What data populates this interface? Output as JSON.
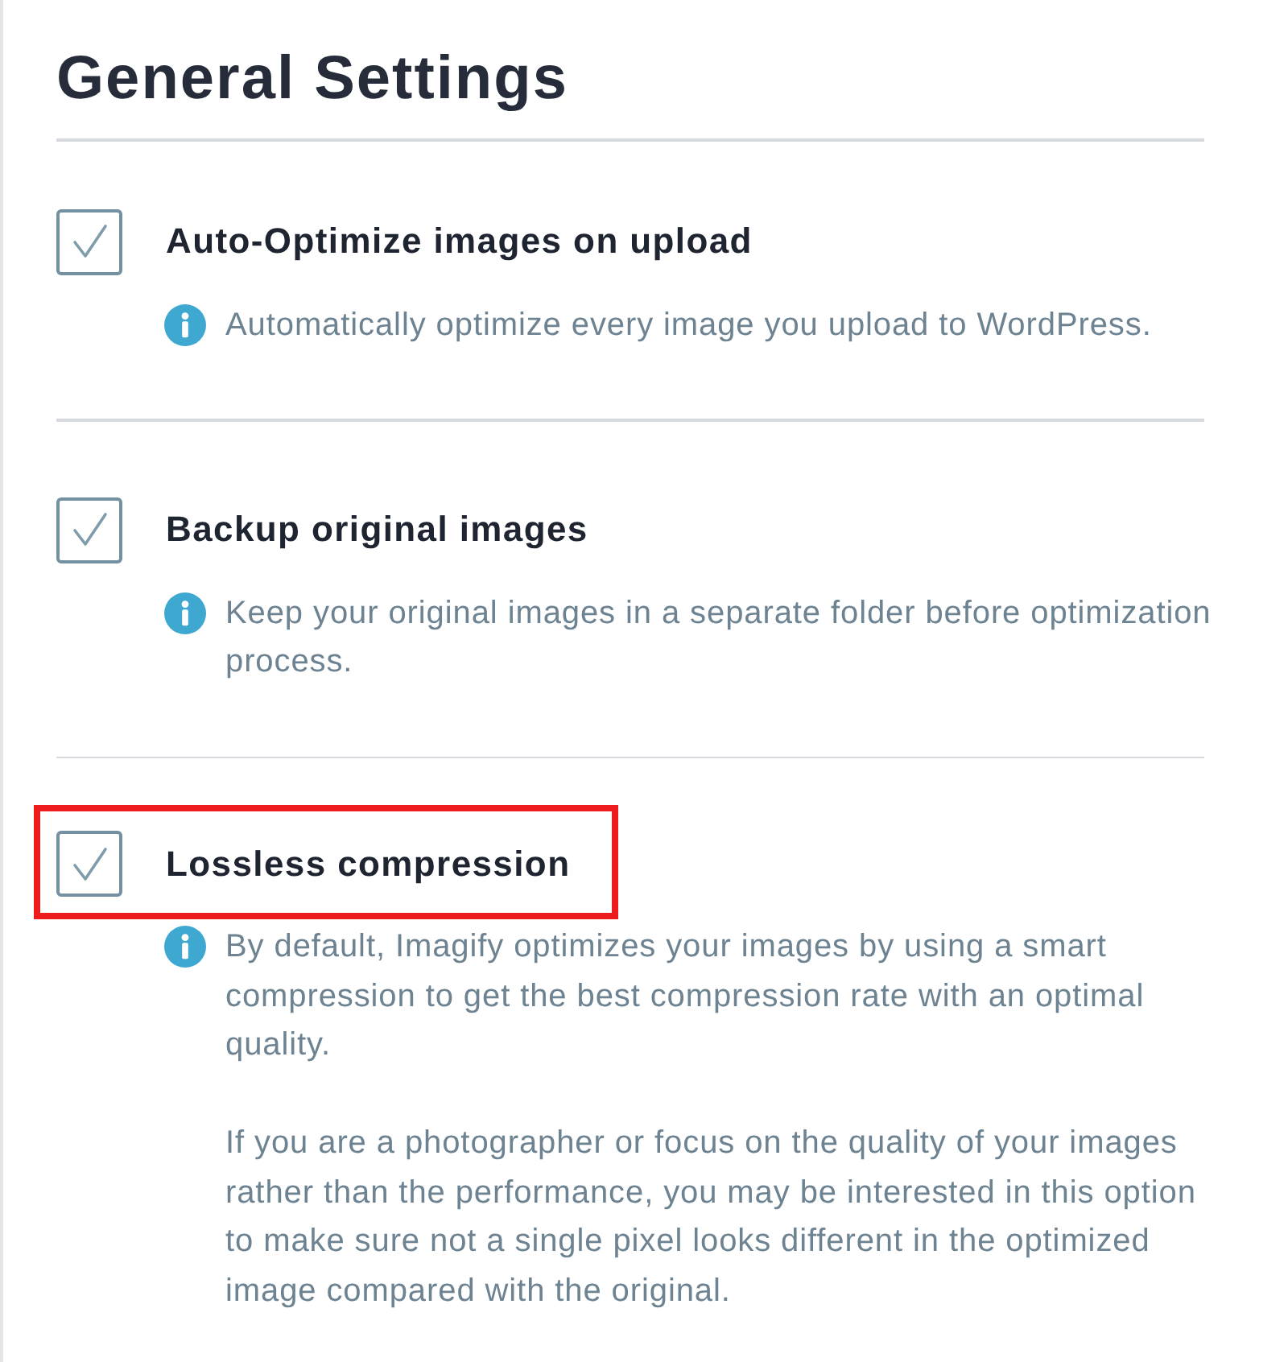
{
  "title": "General Settings",
  "settings": [
    {
      "label": "Auto-Optimize images on upload",
      "checked": true,
      "highlighted": false,
      "description": [
        "Automatically optimize every image you upload to WordPress."
      ]
    },
    {
      "label": "Backup original images",
      "checked": true,
      "highlighted": false,
      "description": [
        "Keep your original images in a separate folder before optimization process."
      ]
    },
    {
      "label": "Lossless compression",
      "checked": true,
      "highlighted": true,
      "description": [
        "By default, Imagify optimizes your images by using a smart compression to get the best compression rate with an optimal quality.",
        "If you are a photographer or focus on the quality of your images rather than the performance, you may be interested in this option to make sure not a single pixel looks different in the optimized image compared with the original."
      ]
    }
  ]
}
